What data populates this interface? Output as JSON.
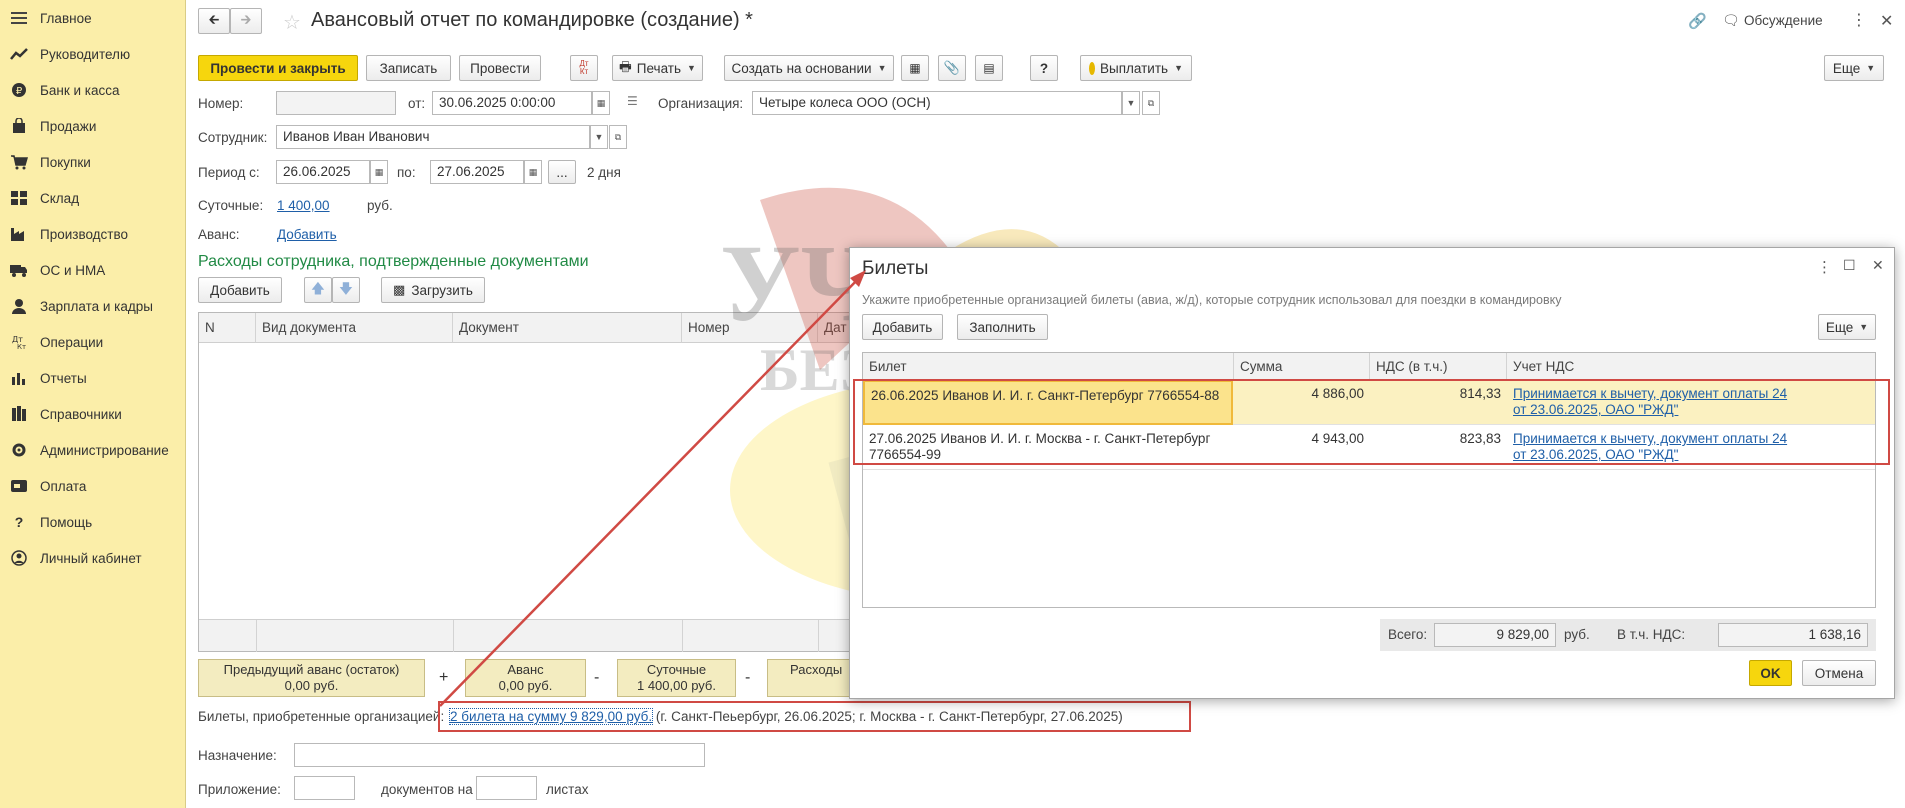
{
  "sidebar": {
    "items": [
      {
        "label": "Главное",
        "icon": "menu-icon"
      },
      {
        "label": "Руководителю",
        "icon": "trend-icon"
      },
      {
        "label": "Банк и касса",
        "icon": "coin-icon"
      },
      {
        "label": "Продажи",
        "icon": "bag-icon"
      },
      {
        "label": "Покупки",
        "icon": "cart-icon"
      },
      {
        "label": "Склад",
        "icon": "warehouse-icon"
      },
      {
        "label": "Производство",
        "icon": "factory-icon"
      },
      {
        "label": "ОС и НМА",
        "icon": "truck-icon"
      },
      {
        "label": "Зарплата и кадры",
        "icon": "person-icon"
      },
      {
        "label": "Операции",
        "icon": "operations-icon"
      },
      {
        "label": "Отчеты",
        "icon": "bar-chart-icon"
      },
      {
        "label": "Справочники",
        "icon": "books-icon"
      },
      {
        "label": "Администрирование",
        "icon": "gear-icon"
      },
      {
        "label": "Оплата",
        "icon": "payment-icon"
      },
      {
        "label": "Помощь",
        "icon": "question-icon"
      },
      {
        "label": "Личный кабинет",
        "icon": "account-icon"
      }
    ]
  },
  "header": {
    "title": "Авансовый отчет по командировке (создание) *",
    "discussion": "Обсуждение"
  },
  "toolbar": {
    "post_close": "Провести и закрыть",
    "save": "Записать",
    "post": "Провести",
    "print": "Печать",
    "create_based": "Создать на основании",
    "pay": "Выплатить",
    "help": "?",
    "more": "Еще"
  },
  "form": {
    "number_label": "Номер:",
    "number_value": "",
    "date_label": "от:",
    "date_value": "30.06.2025  0:00:00",
    "org_label": "Организация:",
    "org_value": "Четыре колеса ООО (ОСН)",
    "employee_label": "Сотрудник:",
    "employee_value": "Иванов Иван Иванович",
    "period_label": "Период с:",
    "period_from": "26.06.2025",
    "period_to_label": "по:",
    "period_to": "27.06.2025",
    "period_dots": "...",
    "period_days": "2 дня",
    "per_diem_label": "Суточные:",
    "per_diem_value": "1 400,00",
    "per_diem_unit": "руб.",
    "advance_label": "Аванс:",
    "advance_link": "Добавить"
  },
  "expenses": {
    "title": "Расходы сотрудника, подтвержденные документами",
    "add": "Добавить",
    "load": "Загрузить",
    "columns": [
      "N",
      "Вид документа",
      "Документ",
      "Номер",
      "Дат"
    ]
  },
  "totals": {
    "prev_advance_label": "Предыдущий аванс (остаток)",
    "prev_advance_value": "0,00 руб.",
    "plus": "+",
    "advance_label": "Аванс",
    "advance_value": "0,00 руб.",
    "minus1": "-",
    "per_diem_label": "Суточные",
    "per_diem_value": "1 400,00 руб.",
    "minus2": "-",
    "expenses_label": "Расходы"
  },
  "tickets_line": {
    "label": "Билеты, приобретенные организацией:",
    "link": "2 билета на сумму 9 829,00 руб.",
    "detail": " (г. Санкт-Пеьербург, 26.06.2025; г. Москва - г. Санкт-Петербург, 27.06.2025)"
  },
  "purpose_label": "Назначение:",
  "attachment": {
    "label": "Приложение:",
    "docs_label": "документов на",
    "sheets_label": "листах"
  },
  "dialog": {
    "title": "Билеты",
    "hint": "Укажите приобретенные организацией билеты (авиа, ж/д), которые сотрудник использовал для поездки в командировку",
    "add": "Добавить",
    "fill": "Заполнить",
    "more": "Еще",
    "columns": [
      "Билет",
      "Сумма",
      "НДС (в т.ч.)",
      "Учет НДС"
    ],
    "rows": [
      {
        "ticket": "26.06.2025 Иванов И. И. г. Санкт-Петербург 7766554-88",
        "sum": "4 886,00",
        "vat": "814,33",
        "vat_link": "Принимается к вычету, документ оплаты 24 от 23.06.2025, ОАО \"РЖД\""
      },
      {
        "ticket": "27.06.2025 Иванов И. И. г. Москва - г. Санкт-Петербург 7766554-99",
        "sum": "4 943,00",
        "vat": "823,83",
        "vat_link": "Принимается к вычету, документ оплаты 24 от 23.06.2025, ОАО \"РЖД\""
      }
    ],
    "total_label": "Всего:",
    "total_value": "9 829,00",
    "total_unit": "руб.",
    "vat_label": "В т.ч. НДС:",
    "vat_value": "1 638,16",
    "ok": "OK",
    "cancel": "Отмена"
  },
  "watermark": {
    "text_top": "УЧЕТ",
    "text_bottom": "БЕЗ ЗАБОТ"
  },
  "colors": {
    "accent": "#f6d60d",
    "sidebar_bg": "#fbeea9",
    "highlight": "#d04a44",
    "link": "#1f5fa8",
    "green": "#218a45"
  }
}
